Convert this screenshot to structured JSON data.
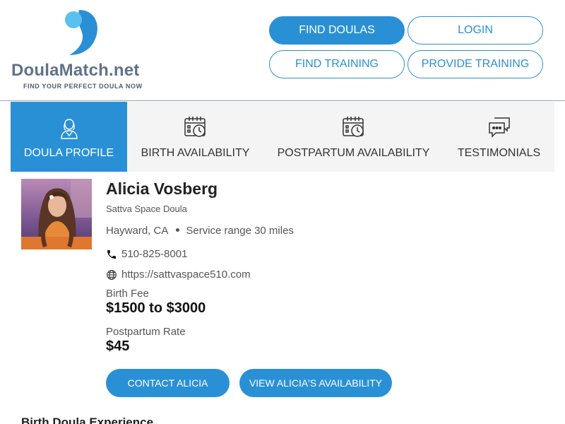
{
  "brand": {
    "name_part1": "Doula",
    "name_part2": "Match.net",
    "tagline": "FIND YOUR PERFECT DOULA NOW",
    "colors": {
      "primary": "#2a90d6",
      "logo_light": "#5bc0f0",
      "logo_text": "#5e7388"
    }
  },
  "nav": {
    "find_doulas": "FIND DOULAS",
    "login": "LOGIN",
    "find_training": "FIND TRAINING",
    "provide_training": "PROVIDE TRAINING"
  },
  "tabs": [
    {
      "label": "DOULA PROFILE",
      "icon": "doula-person-icon",
      "active": true
    },
    {
      "label": "BIRTH AVAILABILITY",
      "icon": "calendar-clock-icon",
      "active": false
    },
    {
      "label": "POSTPARTUM AVAILABILITY",
      "icon": "calendar-clock-icon",
      "active": false
    },
    {
      "label": "TESTIMONIALS",
      "icon": "chat-bubbles-icon",
      "active": false
    }
  ],
  "profile": {
    "name": "Alicia Vosberg",
    "organization": "Sattva Space Doula",
    "city": "Hayward, CA",
    "service_range": "Service range 30 miles",
    "phone": "510-825-8001",
    "website": "https://sattvaspace510.com",
    "birth_fee_label": "Birth Fee",
    "birth_fee": "$1500 to $3000",
    "postpartum_label": "Postpartum Rate",
    "postpartum_rate": "$45",
    "contact_button": "CONTACT ALICIA",
    "availability_button": "VIEW ALICIA'S AVAILABILITY"
  },
  "sections": {
    "birth_experience_title": "Birth Doula Experience"
  }
}
